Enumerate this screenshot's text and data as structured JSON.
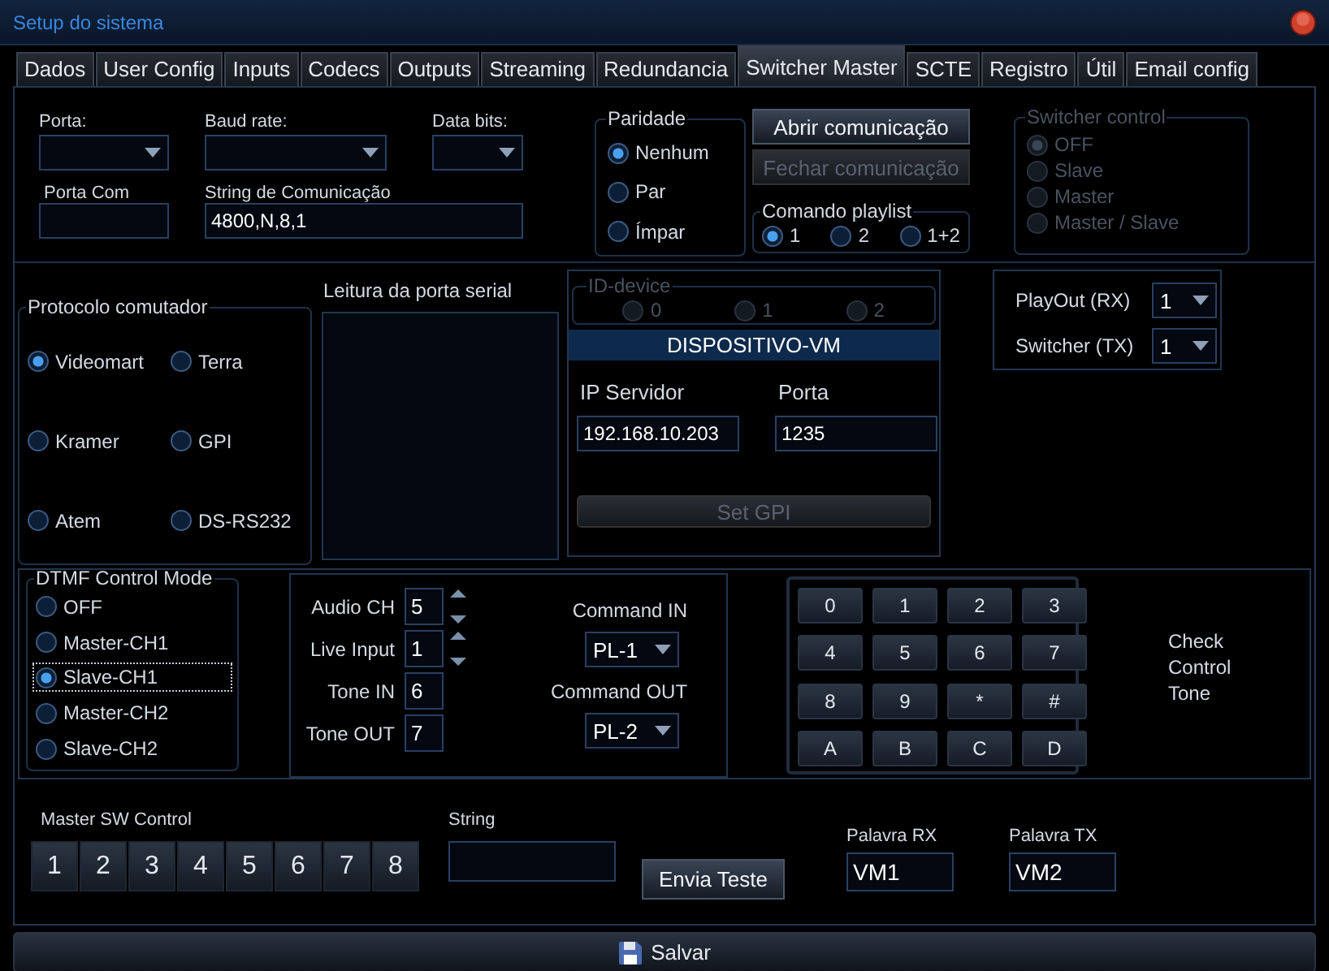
{
  "window": {
    "title": "Setup do sistema"
  },
  "tabs": [
    {
      "label": "Dados",
      "selected": false
    },
    {
      "label": "User Config",
      "selected": false
    },
    {
      "label": "Inputs",
      "selected": false
    },
    {
      "label": "Codecs",
      "selected": false
    },
    {
      "label": "Outputs",
      "selected": false
    },
    {
      "label": "Streaming",
      "selected": false
    },
    {
      "label": "Redundancia",
      "selected": false
    },
    {
      "label": "Switcher Master",
      "selected": true
    },
    {
      "label": "SCTE",
      "selected": false
    },
    {
      "label": "Registro",
      "selected": false
    },
    {
      "label": "Útil",
      "selected": false
    },
    {
      "label": "Email config",
      "selected": false
    }
  ],
  "serial": {
    "porta": {
      "label": "Porta:"
    },
    "baud_rate": {
      "label": "Baud rate:"
    },
    "data_bits": {
      "label": "Data bits:"
    },
    "porta_com": {
      "label": "Porta  Com"
    },
    "string": {
      "label": "String de Comunicação",
      "value": "4800,N,8,1"
    }
  },
  "paridade": {
    "title": "Paridade",
    "options": [
      {
        "label": "Nenhum",
        "selected": true
      },
      {
        "label": "Par",
        "selected": false
      },
      {
        "label": "Ímpar",
        "selected": false
      }
    ]
  },
  "connection_buttons": [
    {
      "label": "Abrir comunicação",
      "disabled": false
    },
    {
      "label": "Fechar comunicação",
      "disabled": true
    }
  ],
  "comando_playlist": {
    "title": "Comando playlist",
    "options": [
      {
        "label": "1",
        "selected": true
      },
      {
        "label": "2",
        "selected": false
      },
      {
        "label": "1+2",
        "selected": false
      }
    ]
  },
  "switcher_control": {
    "title": "Switcher control",
    "disabled": true,
    "options": [
      {
        "label": "OFF",
        "selected": true
      },
      {
        "label": "Slave",
        "selected": false
      },
      {
        "label": "Master",
        "selected": false
      },
      {
        "label": "Master / Slave",
        "selected": false
      }
    ]
  },
  "protocolo": {
    "title": "Protocolo  comutador",
    "options": [
      {
        "label": "Videomart",
        "selected": true
      },
      {
        "label": "Terra",
        "selected": false
      },
      {
        "label": "Kramer",
        "selected": false
      },
      {
        "label": "GPI",
        "selected": false
      },
      {
        "label": "Atem",
        "selected": false
      },
      {
        "label": "DS-RS232",
        "selected": false
      }
    ]
  },
  "leitura": {
    "title": "Leitura da porta serial"
  },
  "id_device": {
    "title": "ID-device",
    "disabled": true,
    "options": [
      {
        "label": "0",
        "selected": false
      },
      {
        "label": "1",
        "selected": false
      },
      {
        "label": "2",
        "selected": false
      }
    ]
  },
  "device": {
    "title": "DISPOSITIVO-VM",
    "ip": {
      "label": "IP Servidor",
      "value": "192.168.10.203"
    },
    "porta": {
      "label": "Porta",
      "value": "1235"
    },
    "set_gpi": {
      "label": "Set GPI",
      "disabled": true
    }
  },
  "routing": [
    {
      "label": "PlayOut  (RX)",
      "value": "1"
    },
    {
      "label": "Switcher (TX)",
      "value": "1"
    }
  ],
  "dtmf": {
    "title": "DTMF Control Mode",
    "options": [
      {
        "label": "OFF",
        "selected": false,
        "focused": false
      },
      {
        "label": "Master-CH1",
        "selected": false,
        "focused": false
      },
      {
        "label": "Slave-CH1",
        "selected": true,
        "focused": true
      },
      {
        "label": "Master-CH2",
        "selected": false,
        "focused": false
      },
      {
        "label": "Slave-CH2",
        "selected": false,
        "focused": false
      }
    ]
  },
  "audio": [
    {
      "label": "Audio CH",
      "value": "5",
      "kind": "spin"
    },
    {
      "label": "Live Input",
      "value": "1",
      "kind": "spin"
    },
    {
      "label": "Tone IN",
      "value": "6",
      "kind": "text"
    },
    {
      "label": "Tone OUT",
      "value": "7",
      "kind": "text"
    }
  ],
  "commands": [
    {
      "label": "Command IN",
      "value": "PL-1"
    },
    {
      "label": "Command OUT",
      "value": "PL-2"
    }
  ],
  "keypad": [
    "0",
    "1",
    "2",
    "3",
    "4",
    "5",
    "6",
    "7",
    "8",
    "9",
    "*",
    "#",
    "A",
    "B",
    "C",
    "D"
  ],
  "check_label": "Check Control Tone",
  "master_sw": {
    "title": "Master SW Control",
    "buttons": [
      "1",
      "2",
      "3",
      "4",
      "5",
      "6",
      "7",
      "8"
    ]
  },
  "string_test": {
    "label": "String",
    "button": "Envia Teste"
  },
  "palavras": [
    {
      "label": "Palavra RX",
      "value": "VM1"
    },
    {
      "label": "Palavra TX",
      "value": "VM2"
    }
  ],
  "save": {
    "label": "Salvar"
  }
}
